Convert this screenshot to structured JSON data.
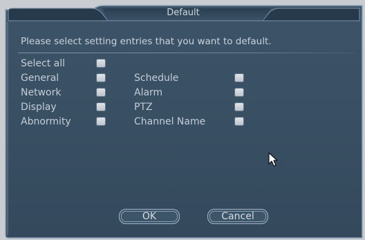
{
  "dialog": {
    "title": "Default",
    "instruction": "Please select setting entries that you want to default."
  },
  "options": {
    "select_all": "Select all",
    "general": "General",
    "network": "Network",
    "display": "Display",
    "abnormity": "Abnormity",
    "schedule": "Schedule",
    "alarm": "Alarm",
    "ptz": "PTZ",
    "channel_name": "Channel Name"
  },
  "buttons": {
    "ok": "OK",
    "cancel": "Cancel"
  },
  "colors": {
    "panel": "#394f63",
    "title_bar": "#324a60",
    "text": "#c3cdd8",
    "checkbox": "#d3d8de"
  },
  "icons": {
    "cursor": "arrow-cursor-icon"
  }
}
